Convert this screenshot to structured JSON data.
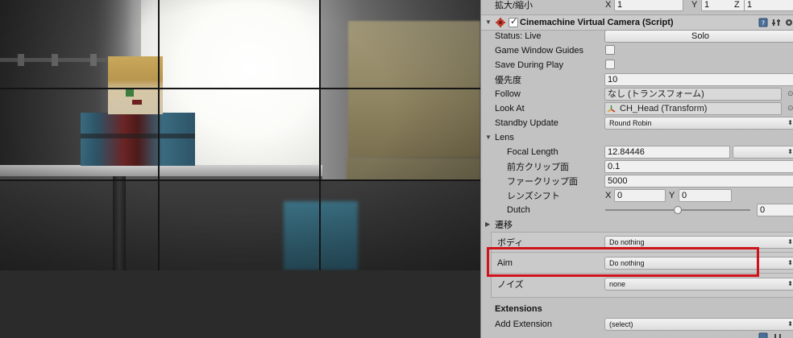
{
  "transform_scale": {
    "label": "拡大/縮小",
    "x_label": "X",
    "x": "1",
    "y_label": "Y",
    "y": "1",
    "z_label": "Z",
    "z": "1"
  },
  "component": {
    "title": "Cinemachine Virtual Camera (Script)",
    "enabled": true,
    "icons": [
      "book-icon",
      "preset-icon",
      "gear-icon"
    ]
  },
  "status": {
    "label": "Status: Live",
    "button": "Solo"
  },
  "game_window_guides": {
    "label": "Game Window Guides",
    "checked": false
  },
  "save_during_play": {
    "label": "Save During Play",
    "checked": false
  },
  "priority": {
    "label": "優先度",
    "value": "10"
  },
  "follow": {
    "label": "Follow",
    "value": "なし (トランスフォーム)"
  },
  "look_at": {
    "label": "Look At",
    "value": "CH_Head (Transform)"
  },
  "standby_update": {
    "label": "Standby Update",
    "value": "Round Robin"
  },
  "lens": {
    "label": "Lens",
    "focal_length": {
      "label": "Focal Length",
      "value": "12.84446",
      "preset": ""
    },
    "near_clip": {
      "label": "前方クリップ面",
      "value": "0.1"
    },
    "far_clip": {
      "label": "ファークリップ面",
      "value": "5000"
    },
    "lens_shift": {
      "label": "レンズシフト",
      "x_label": "X",
      "x": "0",
      "y_label": "Y",
      "y": "0"
    },
    "dutch": {
      "label": "Dutch",
      "value": "0",
      "slider_fraction": 0.5
    }
  },
  "transitions": {
    "label": "遷移"
  },
  "body": {
    "label": "ボディ",
    "value": "Do nothing"
  },
  "aim": {
    "label": "Aim",
    "value": "Do nothing"
  },
  "noise": {
    "label": "ノイズ",
    "value": "none"
  },
  "extensions": {
    "title": "Extensions",
    "add_label": "Add Extension",
    "add_value": "(select)"
  },
  "colors": {
    "highlight": "#d0121b",
    "inspector_bg": "#c2c2c2"
  }
}
